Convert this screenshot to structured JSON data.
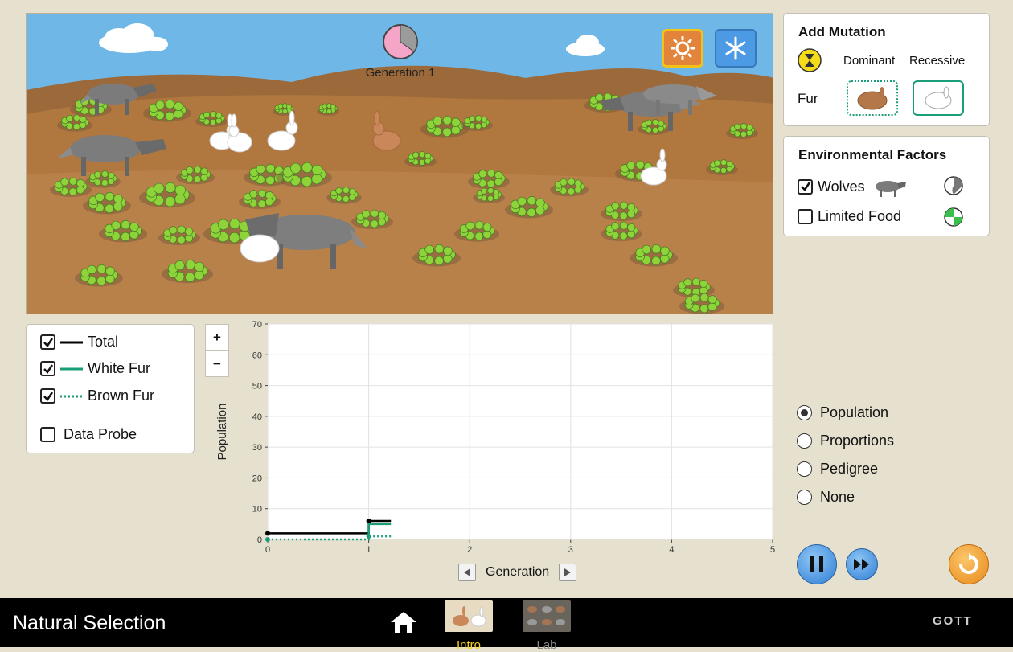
{
  "scene": {
    "generation_label": "Generation 1",
    "generation_clock_progress": 0.35,
    "environment_buttons": [
      {
        "name": "sun-icon",
        "selected": true
      },
      {
        "name": "snowflake-icon",
        "selected": false
      }
    ],
    "colors": {
      "sky": "#6fb7e6",
      "hills": "#a8733f",
      "ground": "#bf8d57",
      "bush": "#8ed33a"
    }
  },
  "mutation_panel": {
    "title": "Add Mutation",
    "dominant_label": "Dominant",
    "recessive_label": "Recessive",
    "trait_label": "Fur",
    "icons": [
      "hourglass-icon",
      "brown-bunny-icon",
      "white-bunny-icon"
    ]
  },
  "environment_panel": {
    "title": "Environmental Factors",
    "factors": [
      {
        "label": "Wolves",
        "checked": true,
        "icon": "wolf-icon",
        "timer_icon": "pie-timer-icon"
      },
      {
        "label": "Limited Food",
        "checked": false,
        "icon": "",
        "timer_icon": "pie-timer-green-icon"
      }
    ]
  },
  "legend": {
    "items": [
      {
        "label": "Total",
        "checked": true,
        "color": "#000000",
        "style": "solid"
      },
      {
        "label": "White Fur",
        "checked": true,
        "color": "#1a9e7a",
        "style": "solid"
      },
      {
        "label": "Brown Fur",
        "checked": true,
        "color": "#1a9e7a",
        "style": "dotted"
      }
    ],
    "data_probe_label": "Data Probe",
    "data_probe_checked": false
  },
  "zoom": {
    "plus": "+",
    "minus": "−"
  },
  "chart_data": {
    "type": "line",
    "xlabel": "Generation",
    "ylabel": "Population",
    "xlim": [
      0,
      5
    ],
    "ylim": [
      0,
      70
    ],
    "xticks": [
      "0",
      "1",
      "2",
      "3",
      "4",
      "5"
    ],
    "yticks": [
      "0",
      "10",
      "20",
      "30",
      "40",
      "50",
      "60",
      "70"
    ],
    "grid": true,
    "series": [
      {
        "name": "Total",
        "color": "#000000",
        "style": "solid",
        "points": [
          [
            0,
            2
          ],
          [
            1,
            2
          ],
          [
            1,
            6
          ],
          [
            1.22,
            6
          ]
        ]
      },
      {
        "name": "White Fur",
        "color": "#1a9e7a",
        "style": "solid",
        "points": [
          [
            1,
            1
          ],
          [
            1,
            5
          ],
          [
            1.22,
            5
          ]
        ]
      },
      {
        "name": "Brown Fur",
        "color": "#1a9e7a",
        "style": "dotted",
        "points": [
          [
            0,
            0
          ],
          [
            1,
            0
          ],
          [
            1,
            1
          ],
          [
            1.22,
            1
          ]
        ]
      }
    ],
    "markers": [
      {
        "series": "Total",
        "x": 0,
        "y": 2
      },
      {
        "series": "Total",
        "x": 1,
        "y": 6
      },
      {
        "series": "White Fur",
        "x": 1,
        "y": 1
      },
      {
        "series": "Brown Fur",
        "x": 0,
        "y": 0
      }
    ]
  },
  "generation_nav": {
    "label": "Generation"
  },
  "view_options": {
    "options": [
      "Population",
      "Proportions",
      "Pedigree",
      "None"
    ],
    "selected": "Population"
  },
  "controls": {
    "pause_icon": "pause-icon",
    "step_icon": "fast-forward-icon",
    "reset_icon": "reset-icon"
  },
  "navbar": {
    "title": "Natural Selection",
    "home_icon": "home-icon",
    "tabs": [
      {
        "label": "Intro",
        "active": true
      },
      {
        "label": "Lab",
        "active": false
      }
    ],
    "brand": "GOTT"
  }
}
